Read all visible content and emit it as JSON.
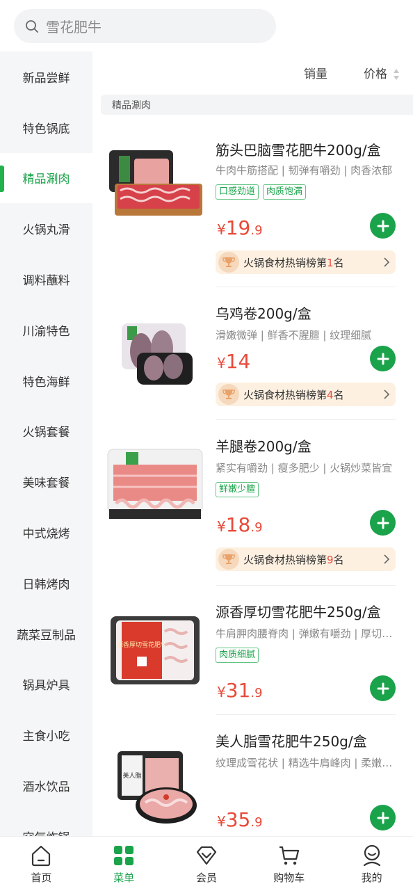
{
  "search": {
    "placeholder": "雪花肥牛"
  },
  "sidebar": {
    "items": [
      {
        "label": "新品尝鲜"
      },
      {
        "label": "特色锅底"
      },
      {
        "label": "精品涮肉",
        "active": true
      },
      {
        "label": "火锅丸滑"
      },
      {
        "label": "调料蘸料"
      },
      {
        "label": "川渝特色"
      },
      {
        "label": "特色海鲜"
      },
      {
        "label": "火锅套餐"
      },
      {
        "label": "美味套餐"
      },
      {
        "label": "中式烧烤"
      },
      {
        "label": "日韩烤肉"
      },
      {
        "label": "蔬菜豆制品"
      },
      {
        "label": "锅具炉具"
      },
      {
        "label": "主食小吃"
      },
      {
        "label": "酒水饮品"
      },
      {
        "label": "空气炸锅"
      }
    ]
  },
  "sort": {
    "sales": "销量",
    "price": "价格"
  },
  "section": {
    "title": "精品涮肉"
  },
  "products": [
    {
      "name": "筋头巴脑雪花肥牛200g/盒",
      "desc": "牛肉牛筋搭配 | 韧弹有嚼劲 | 肉香浓郁",
      "tags": [
        "口感劲道",
        "肉质饱满"
      ],
      "price": {
        "yen": "¥",
        "int": "19",
        "dec": ".9"
      },
      "rank": {
        "prefix": "火锅食材热销榜第",
        "num": "1",
        "suffix": "名"
      }
    },
    {
      "name": "乌鸡卷200g/盒",
      "desc": "滑嫩微弹 | 鲜香不腥膻 | 纹理细腻",
      "tags": [],
      "price": {
        "yen": "¥",
        "int": "14",
        "dec": ""
      },
      "rank": {
        "prefix": "火锅食材热销榜第",
        "num": "4",
        "suffix": "名"
      }
    },
    {
      "name": "羊腿卷200g/盒",
      "desc": "紧实有嚼劲 | 瘦多肥少 | 火锅炒菜皆宜",
      "tags": [
        "鲜嫩少膻"
      ],
      "price": {
        "yen": "¥",
        "int": "18",
        "dec": ".9"
      },
      "rank": {
        "prefix": "火锅食材热销榜第",
        "num": "9",
        "suffix": "名"
      }
    },
    {
      "name": "源香厚切雪花肥牛250g/盒",
      "desc": "牛肩胛肉腰脊肉 | 弹嫩有嚼劲 | 厚切过瘾",
      "tags": [
        "肉质细腻"
      ],
      "price": {
        "yen": "¥",
        "int": "31",
        "dec": ".9"
      },
      "rank": null
    },
    {
      "name": "美人脂雪花肥牛250g/盒",
      "desc": "纹理成雪花状 | 精选牛肩峰肉 | 柔嫩多汁",
      "tags": [],
      "price": {
        "yen": "¥",
        "int": "35",
        "dec": ".9"
      },
      "rank": null
    }
  ],
  "image_labels": {
    "p4_box": "源香厚切雪花肥牛",
    "p5_box": "美人脂"
  },
  "tabbar": {
    "items": [
      {
        "label": "首页",
        "icon": "home-icon"
      },
      {
        "label": "菜单",
        "icon": "menu-grid-icon",
        "active": true
      },
      {
        "label": "会员",
        "icon": "member-diamond-icon"
      },
      {
        "label": "购物车",
        "icon": "cart-icon"
      },
      {
        "label": "我的",
        "icon": "profile-icon"
      }
    ]
  },
  "colors": {
    "accent": "#1aa34a",
    "price": "#e84a3a",
    "rank_bg": "#fdf0e1"
  }
}
